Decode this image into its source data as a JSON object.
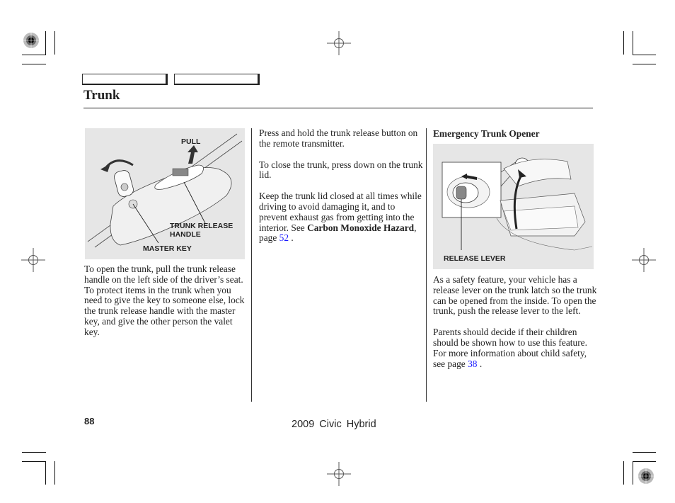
{
  "page": {
    "title": "Trunk",
    "page_number": "88",
    "footer_title": "2009  Civic  Hybrid"
  },
  "column1": {
    "figure": {
      "callouts": {
        "pull": "PULL",
        "trunk_release_handle_line1": "TRUNK RELEASE",
        "trunk_release_handle_line2": "HANDLE",
        "master_key": "MASTER KEY"
      }
    },
    "paragraph": "To open the trunk, pull the trunk release handle on the left side of the driver’s seat. To protect items in the trunk when you need to give the key to someone else, lock the trunk release handle with the master key, and give the other person the valet key."
  },
  "column2": {
    "paragraph1": "Press and hold the trunk release button on the remote transmitter.",
    "paragraph2": "To close the trunk, press down on the trunk lid.",
    "paragraph3_text": "Keep the trunk lid closed at all times while driving to avoid damaging it, and to prevent exhaust gas from getting into the interior. See ",
    "paragraph3_bold": "Carbon Monoxide Hazard",
    "paragraph3_mid": ", page ",
    "paragraph3_link": "52",
    "paragraph3_end": " ."
  },
  "column3": {
    "heading": "Emergency Trunk Opener",
    "figure": {
      "callouts": {
        "release_lever": "RELEASE LEVER"
      }
    },
    "paragraph1": "As a safety feature, your vehicle has a release lever on the trunk latch so the trunk can be opened from the inside. To open the trunk, push the release lever to the left.",
    "paragraph2_text": "Parents should decide if their children should be shown how to use this feature. For more information about child safety, see page ",
    "paragraph2_link": "38",
    "paragraph2_end": " ."
  },
  "colors": {
    "link": "#1a1aff",
    "figure_bg": "#e6e6e6",
    "text": "#222222"
  }
}
